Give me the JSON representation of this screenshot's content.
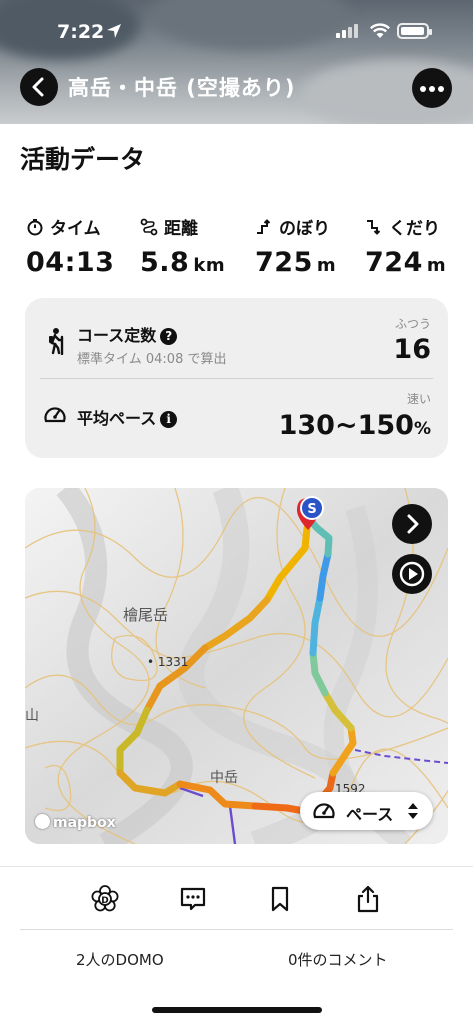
{
  "status_bar": {
    "time": "7:22"
  },
  "header": {
    "title": "高岳・中岳 (空撮あり)"
  },
  "activity": {
    "section_title": "活動データ",
    "stats": [
      {
        "label": "タイム",
        "value": "04:13",
        "unit": "",
        "icon": "stopwatch-icon"
      },
      {
        "label": "距離",
        "value": "5.8",
        "unit": "km",
        "icon": "distance-icon"
      },
      {
        "label": "のぼり",
        "value": "725",
        "unit": "m",
        "icon": "ascent-icon"
      },
      {
        "label": "くだり",
        "value": "724",
        "unit": "m",
        "icon": "descent-icon"
      }
    ]
  },
  "course": {
    "label": "コース定数",
    "help": "?",
    "sub": "標準タイム 04:08 で算出",
    "tag": "ふつう",
    "value": "16"
  },
  "pace": {
    "label": "平均ペース",
    "info": "i",
    "tag": "速い",
    "value": "130~150",
    "unit": "%"
  },
  "map": {
    "labels": {
      "peak1": "檜尾岳",
      "elev1": "• 1331",
      "peak2": "中岳",
      "elev2": "1592",
      "left": "山"
    },
    "start_marker": "S",
    "pace_button": "ペース",
    "attribution": "mapbox"
  },
  "footer": {
    "domo": "2人のDOMO",
    "comments": "0件のコメント"
  }
}
